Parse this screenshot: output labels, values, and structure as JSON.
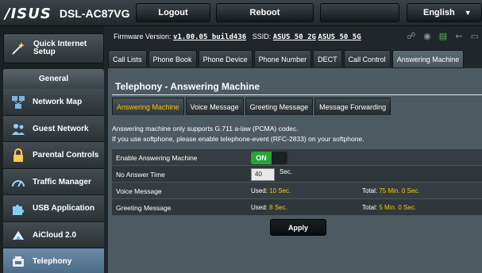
{
  "header": {
    "brand": "/ISUS",
    "model": "DSL-AC87VG",
    "logout_label": "Logout",
    "reboot_label": "Reboot",
    "language_label": "English"
  },
  "sidebar": {
    "quick_setup_label": "Quick Internet Setup",
    "section_title": "General",
    "items": [
      {
        "label": "Network Map",
        "icon": "network-map-icon"
      },
      {
        "label": "Guest Network",
        "icon": "guest-network-icon"
      },
      {
        "label": "Parental Controls",
        "icon": "lock-icon"
      },
      {
        "label": "Traffic Manager",
        "icon": "gauge-icon"
      },
      {
        "label": "USB Application",
        "icon": "puzzle-icon"
      },
      {
        "label": "AiCloud 2.0",
        "icon": "cloud-icon"
      },
      {
        "label": "Telephony",
        "icon": "phone-icon",
        "active": true
      }
    ]
  },
  "status_bar": {
    "firmware_prefix": "Firmware Version:",
    "firmware_version": "v1.00.05_build436",
    "ssid_prefix": "SSID:",
    "ssid_2g": "ASUS_50_2G",
    "ssid_5g": "ASUS_50_5G"
  },
  "tabs": [
    {
      "label": "Call Lists"
    },
    {
      "label": "Phone Book"
    },
    {
      "label": "Phone Device"
    },
    {
      "label": "Phone Number"
    },
    {
      "label": "DECT"
    },
    {
      "label": "Call Control"
    },
    {
      "label": "Answering Machine",
      "active": true
    }
  ],
  "panel": {
    "title": "Telephony - Answering Machine",
    "subtabs": [
      {
        "label": "Answering Machine",
        "active": true
      },
      {
        "label": "Voice Message"
      },
      {
        "label": "Greeting Message"
      },
      {
        "label": "Message Forwarding"
      }
    ],
    "note_1": "Answering machine only supports G.711 a-law (PCMA) codec.",
    "note_2": "If you use softphone, please enable telephone-event (RFC-2833) on your softphone.",
    "rows": {
      "enable_label": "Enable Answering Machine",
      "enable_state": "ON",
      "no_answer_label": "No Answer Time",
      "no_answer_value": "40",
      "no_answer_unit": "Sec.",
      "voice_label": "Voice Message",
      "voice_used_prefix": "Used:",
      "voice_used_value": "10 Sec.",
      "voice_total_prefix": "Total:",
      "voice_total_value": "75 Min.  0 Sec.",
      "greeting_label": "Greeting Message",
      "greeting_used_prefix": "Used:",
      "greeting_used_value": "8 Sec.",
      "greeting_total_prefix": "Total:",
      "greeting_total_value": "5 Min.  0 Sec."
    },
    "apply_label": "Apply"
  },
  "colors": {
    "accent_yellow": "#ffc107",
    "toggle_on": "#25a633",
    "active_nav": "#5a7a97"
  }
}
